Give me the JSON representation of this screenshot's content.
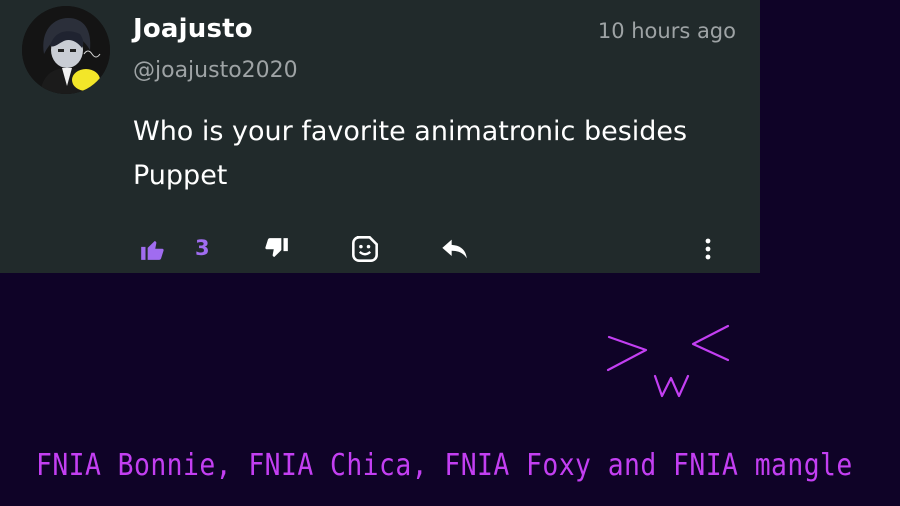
{
  "comment": {
    "author": {
      "display_name": "Joajusto",
      "handle": "@joajusto2020"
    },
    "timestamp": "10 hours ago",
    "body": "Who is your favorite animatronic besides Puppet",
    "actions": {
      "like_count": "3",
      "icons": [
        "thumbs-up-icon",
        "thumbs-down-icon",
        "sticker-icon",
        "reply-icon",
        "more-options-icon"
      ]
    }
  },
  "drawing": {
    "face_text": ">w<",
    "caption": "FNIA Bonnie, FNIA Chica, FNIA Foxy and FNIA mangle"
  },
  "colors": {
    "card_background": "#212a2b",
    "page_background": "#0f0327",
    "accent_purple": "#a06cf0",
    "drawing_magenta": "#c33ff2",
    "secondary_text": "#9ea3a5"
  }
}
